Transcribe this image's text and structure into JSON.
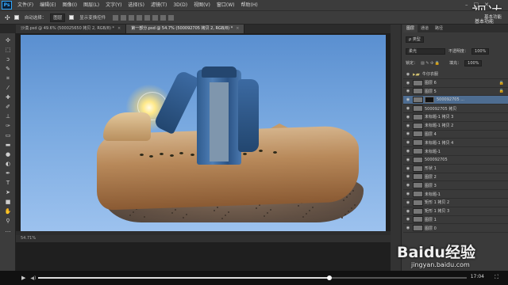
{
  "app": {
    "logo": "Ps",
    "window_controls": [
      "–",
      "□",
      "✕"
    ]
  },
  "menubar": {
    "items": [
      "文件(F)",
      "编辑(E)",
      "图像(I)",
      "图层(L)",
      "文字(Y)",
      "选择(S)",
      "滤镜(T)",
      "3D(D)",
      "视图(V)",
      "窗口(W)",
      "帮助(H)"
    ]
  },
  "watermark": {
    "top": "视达",
    "top_sub": "基本功能",
    "baidu": "Baidu经验",
    "url": "jingyan.baidu.com"
  },
  "options_bar": {
    "auto_select_label": "自动选择：",
    "auto_select_value": "图层",
    "transform_label": "显示变换控件",
    "workspace": "基本功能"
  },
  "tabs": [
    {
      "label": "沙漠.psd @ 49.6% (500025650 拷贝 2, RGB/8) *",
      "active": false
    },
    {
      "label": "第一部分.psd @ 54.7% (500092705 拷贝 2, RGB/8) *",
      "active": true
    }
  ],
  "statusbar": {
    "text": "54.71%"
  },
  "panel": {
    "tabs": [
      "图层",
      "通道",
      "路径"
    ],
    "filter_kind": "ρ 类型",
    "blend_mode": "柔光",
    "opacity_label": "不透明度：",
    "opacity_value": "100%",
    "lock_label": "锁定：",
    "fill_label": "填充：",
    "fill_value": "100%"
  },
  "layers": [
    {
      "name": "牛仔衣服",
      "folder": true,
      "selected": false,
      "locked": false
    },
    {
      "name": "图层 6",
      "folder": false,
      "selected": false,
      "locked": true
    },
    {
      "name": "图层 5",
      "folder": false,
      "selected": false,
      "locked": true
    },
    {
      "name": "500092705 ...",
      "folder": false,
      "selected": true,
      "locked": false
    },
    {
      "name": "500092705 拷贝",
      "folder": false,
      "selected": false,
      "locked": false
    },
    {
      "name": "未标题-1 拷贝 3",
      "folder": false,
      "selected": false,
      "locked": false
    },
    {
      "name": "未标题-1 拷贝 2",
      "folder": false,
      "selected": false,
      "locked": false
    },
    {
      "name": "图层 4",
      "folder": false,
      "selected": false,
      "locked": false
    },
    {
      "name": "未标题-1 拷贝 4",
      "folder": false,
      "selected": false,
      "locked": false
    },
    {
      "name": "未标题-1",
      "folder": false,
      "selected": false,
      "locked": false
    },
    {
      "name": "500092705",
      "folder": false,
      "selected": false,
      "locked": false
    },
    {
      "name": "形状 1",
      "folder": false,
      "selected": false,
      "locked": false
    },
    {
      "name": "图层 2",
      "folder": false,
      "selected": false,
      "locked": false
    },
    {
      "name": "图层 3",
      "folder": false,
      "selected": false,
      "locked": false
    },
    {
      "name": "未标题-1",
      "folder": false,
      "selected": false,
      "locked": false
    },
    {
      "name": "矩形 1 拷贝 2",
      "folder": false,
      "selected": false,
      "locked": false
    },
    {
      "name": "矩形 1 拷贝 3",
      "folder": false,
      "selected": false,
      "locked": false
    },
    {
      "name": "图层 1",
      "folder": false,
      "selected": false,
      "locked": false
    },
    {
      "name": "图层 0",
      "folder": false,
      "selected": false,
      "locked": false
    }
  ],
  "video": {
    "time": "17:04",
    "progress": 0.68,
    "play_icon": "play-icon",
    "volume_icon": "volume-icon"
  }
}
